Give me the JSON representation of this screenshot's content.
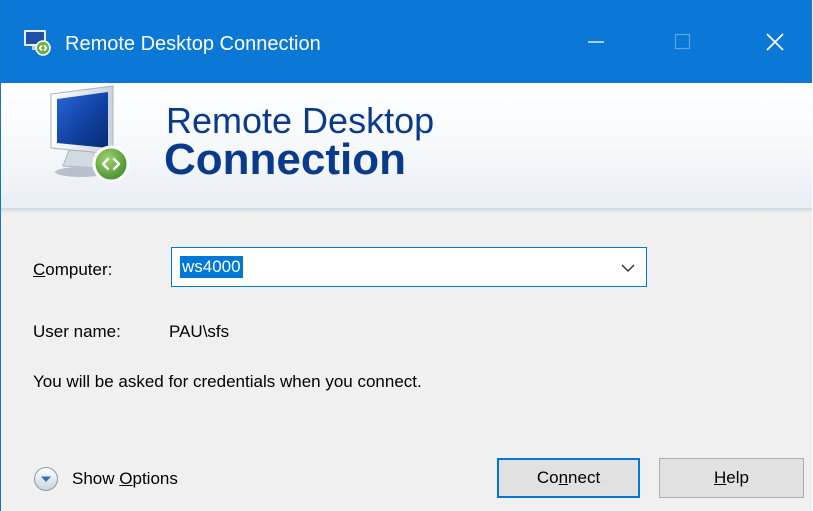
{
  "window": {
    "title": "Remote Desktop Connection",
    "accent_color": "#0b78d7"
  },
  "banner": {
    "line1": "Remote Desktop",
    "line2": "Connection",
    "text_color": "#0a3a8c"
  },
  "form": {
    "computer_label": "Computer:",
    "computer_value": "ws4000",
    "user_label": "User name:",
    "user_value": "PAU\\sfs",
    "info_text": "You will be asked for credentials when you connect."
  },
  "footer": {
    "show_options_label": "Show Options",
    "connect_label": "Connect",
    "help_label": "Help"
  },
  "icons": [
    "remote-desktop-app-icon",
    "minimize-icon",
    "maximize-icon",
    "close-icon",
    "remote-desktop-logo-icon",
    "chevron-down-icon",
    "expand-circle-icon"
  ]
}
